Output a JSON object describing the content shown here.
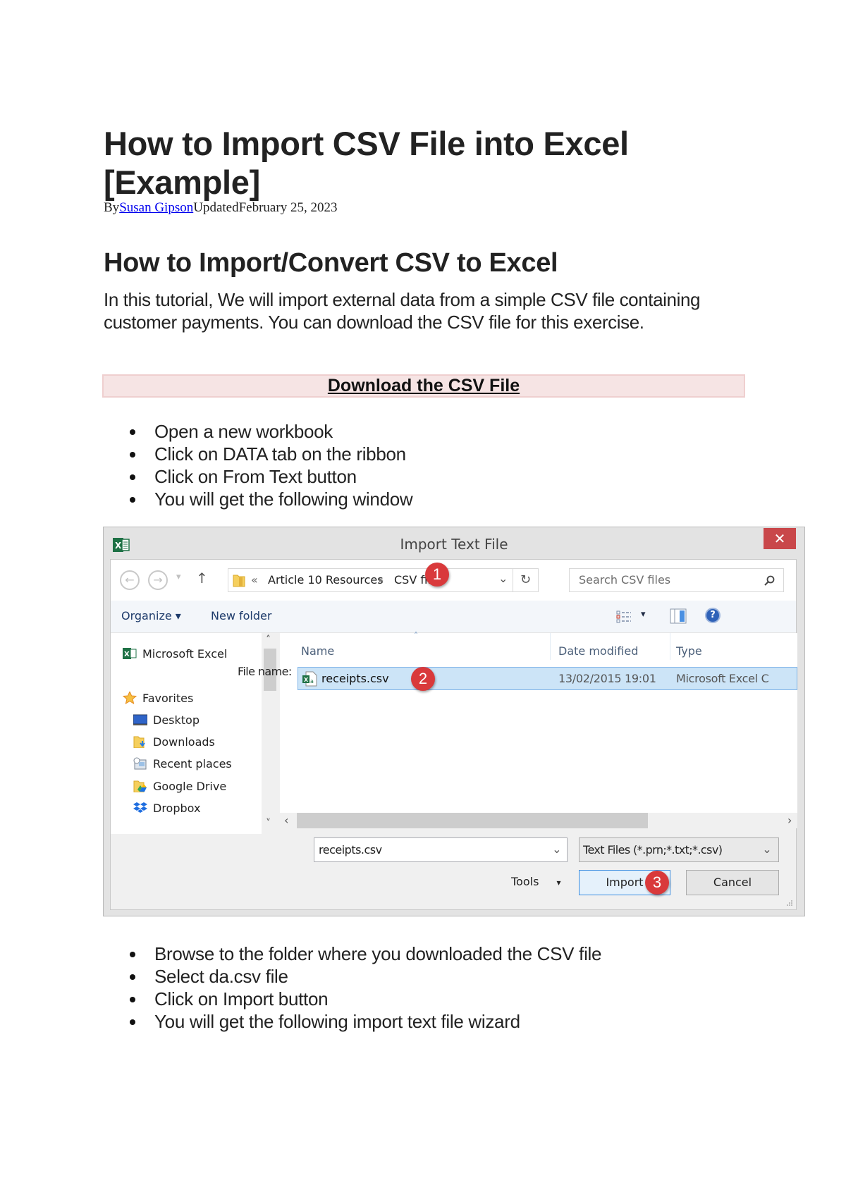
{
  "article": {
    "title": "How to Import CSV File into Excel [Example]",
    "byline_prefix": "By",
    "author": "Susan Gipson",
    "updated_label": "Updated",
    "updated_date": "February 25, 2023",
    "section_heading": "How to Import/Convert CSV to Excel",
    "intro": "In this tutorial, We will import external data from a simple CSV file containing customer payments. You can download the CSV file for this exercise.",
    "download_link": "Download the CSV File",
    "steps_before": [
      "Open a new workbook",
      "Click on DATA tab on the ribbon",
      "Click on From Text button",
      "You will get the following window"
    ],
    "steps_after": [
      "Browse to the folder where you downloaded the CSV file",
      "Select da.csv file",
      "Click on Import button",
      "You will get the following import text file wizard"
    ]
  },
  "dialog": {
    "title": "Import Text File",
    "close_glyph": "✕",
    "nav": {
      "back_glyph": "←",
      "forward_glyph": "→",
      "recent_glyph": "▾",
      "up_glyph": "↑",
      "breadcrumb_overflow": "«",
      "breadcrumb": [
        "Article 10 Resources",
        "CSV files"
      ],
      "breadcrumb_sep": "▸",
      "dropdown_glyph": "⌄",
      "refresh_glyph": "↻",
      "search_placeholder": "Search CSV files",
      "search_glyph": "⚲"
    },
    "toolbar": {
      "organize": "Organize ▾",
      "new_folder": "New folder",
      "view_dropdown": "▾",
      "help_glyph": "?"
    },
    "sidebar": {
      "items": [
        {
          "label": "Microsoft Excel",
          "icon": "excel-icon"
        },
        {
          "label": "Favorites",
          "icon": "star-icon"
        },
        {
          "label": "Desktop",
          "icon": "desktop-icon"
        },
        {
          "label": "Downloads",
          "icon": "downloads-folder-icon"
        },
        {
          "label": "Recent places",
          "icon": "recent-places-icon"
        },
        {
          "label": "Google Drive",
          "icon": "google-drive-folder-icon"
        },
        {
          "label": "Dropbox",
          "icon": "dropbox-icon"
        }
      ],
      "scroll_up": "˄",
      "scroll_down": "˅"
    },
    "file_list": {
      "columns": [
        "Name",
        "Date modified",
        "Type"
      ],
      "sort_glyph": "˄",
      "rows": [
        {
          "name": "receipts.csv",
          "date_modified": "13/02/2015 19:01",
          "type": "Microsoft Excel C",
          "selected": true
        }
      ],
      "scroll_left": "‹",
      "scroll_right": "›"
    },
    "footer": {
      "file_name_label": "File name:",
      "file_name_value": "receipts.csv",
      "file_type_value": "Text Files (*.prn;*.txt;*.csv)",
      "dropdown_glyph": "⌄",
      "tools_label": "Tools",
      "tools_glyph": "▾",
      "import_label": "Import",
      "cancel_label": "Cancel"
    },
    "callouts": [
      "1",
      "2",
      "3"
    ]
  },
  "colors": {
    "download_box_bg": "#f6e4e4",
    "close_button": "#c9474a",
    "callout_badge": "#d9393b",
    "selection_bg": "#cce4f7",
    "link": "#0000ee"
  }
}
